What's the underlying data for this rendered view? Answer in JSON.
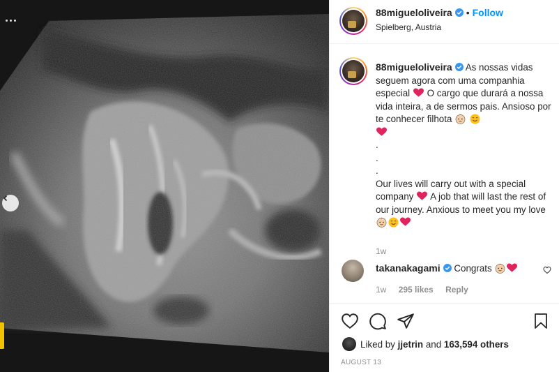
{
  "post": {
    "author": "88migueloliveira",
    "follow_label": "Follow",
    "separator": "•",
    "location": "Spielberg, Austria",
    "more_label": "•••"
  },
  "caption": {
    "author": "88migueloliveira",
    "pt_line1": "As nossas vidas seguem agora com uma companhia especial",
    "pt_line2": "O cargo que durará a nossa vida inteira, a de sermos pais. Ansioso por te conhecer filhota",
    "dots": [
      ".",
      ".",
      "."
    ],
    "en_line1": "Our lives will carry out with a special company",
    "en_line2": "A job that will last the rest of our journey. Anxious to meet you my love",
    "time": "1w"
  },
  "reply": {
    "author": "takanakagami",
    "text": "Congrats",
    "time": "1w",
    "likes": "295 likes",
    "reply_label": "Reply"
  },
  "likes_line": {
    "prefix": "Liked by",
    "user": "jjetrin",
    "middle": "and",
    "count": "163,594 others"
  },
  "date": "AUGUST 13",
  "icons": {
    "like": "heart-icon",
    "comment": "comment-icon",
    "share": "share-icon",
    "save": "bookmark-icon",
    "verified": "verified-badge-icon"
  },
  "colors": {
    "accent": "#0095f6",
    "verified": "#3897f0",
    "heart": "#e0245e",
    "muted": "#8e8e8e"
  }
}
